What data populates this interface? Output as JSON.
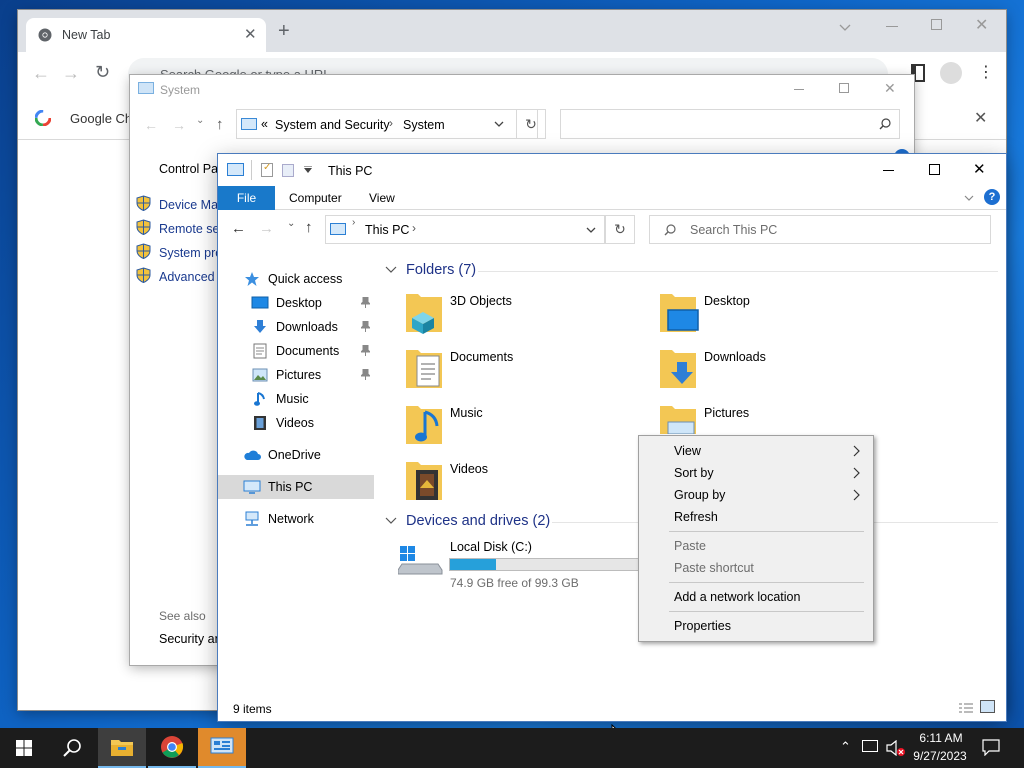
{
  "chrome": {
    "tab_title": "New Tab",
    "omnibox_placeholder": "Search Google or type a URL",
    "bookmark_label": "Google Ch"
  },
  "system_window": {
    "title": "System",
    "breadcrumb": [
      "System and Security",
      "System"
    ],
    "breadcrumb_prefix": "«",
    "sidebar": {
      "home": "Control Par",
      "links": [
        "Device Mar",
        "Remote set",
        "System pro",
        "Advanced s"
      ],
      "see_also": "See also",
      "see_also_link": "Security an"
    }
  },
  "explorer": {
    "title": "This PC",
    "ribbon_tabs": [
      "File",
      "Computer",
      "View"
    ],
    "address": "This PC",
    "search_placeholder": "Search This PC",
    "nav": {
      "quick_access": "Quick access",
      "quick_items": [
        "Desktop",
        "Downloads",
        "Documents",
        "Pictures",
        "Music",
        "Videos"
      ],
      "onedrive": "OneDrive",
      "this_pc": "This PC",
      "network": "Network"
    },
    "folders_header": "Folders (7)",
    "folders": [
      "3D Objects",
      "Desktop",
      "Documents",
      "Downloads",
      "Music",
      "Pictures",
      "Videos"
    ],
    "devices_header": "Devices and drives (2)",
    "drive": {
      "name": "Local Disk (C:)",
      "free_text": "74.9 GB free of 99.3 GB",
      "used_fraction": 0.246
    },
    "status": "9 items"
  },
  "context_menu": {
    "items": [
      {
        "label": "View",
        "submenu": true,
        "enabled": true
      },
      {
        "label": "Sort by",
        "submenu": true,
        "enabled": true
      },
      {
        "label": "Group by",
        "submenu": true,
        "enabled": true
      },
      {
        "label": "Refresh",
        "submenu": false,
        "enabled": true
      },
      {
        "label": "Paste",
        "submenu": false,
        "enabled": false
      },
      {
        "label": "Paste shortcut",
        "submenu": false,
        "enabled": false
      },
      {
        "label": "Add a network location",
        "submenu": false,
        "enabled": true
      },
      {
        "label": "Properties",
        "submenu": false,
        "enabled": true
      }
    ]
  },
  "taskbar": {
    "time": "6:11 AM",
    "date": "9/27/2023",
    "accent": "#0078d7"
  }
}
